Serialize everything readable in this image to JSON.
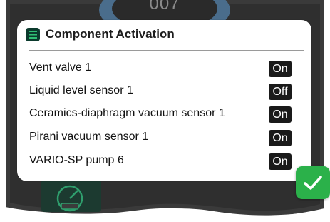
{
  "dialog": {
    "title": "Component Activation",
    "icon": "list-icon",
    "rows": [
      {
        "label": "Vent valve 1",
        "state": "On"
      },
      {
        "label": "Liquid level sensor 1",
        "state": "Off"
      },
      {
        "label": "Ceramics-diaphragm vacuum sensor 1",
        "state": "On"
      },
      {
        "label": "Pirani vacuum sensor 1",
        "state": "On"
      },
      {
        "label": "VARIO-SP pump 6",
        "state": "On"
      }
    ]
  },
  "confirm_button": {
    "icon": "checkmark-icon",
    "color": "#2bb14a"
  },
  "background": {
    "top_dial_text": "007",
    "colors": {
      "frame": "#3c3c3c",
      "dial_ring": "#4a6d8c"
    }
  }
}
